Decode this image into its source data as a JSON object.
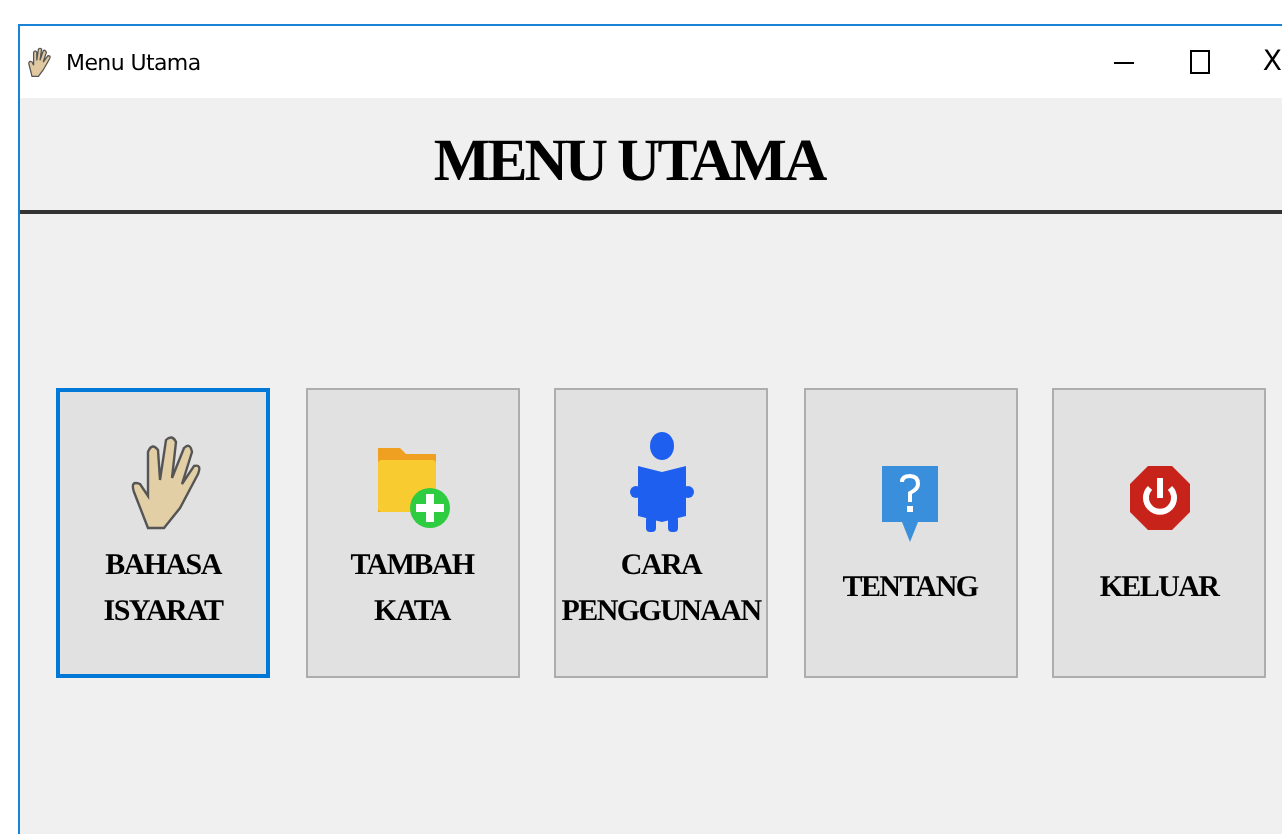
{
  "window": {
    "title": "Menu Utama",
    "close_label": "X"
  },
  "heading": "MENU UTAMA",
  "buttons": [
    {
      "label": "BAHASA\nISYARAT",
      "kind": "hand",
      "selected": true
    },
    {
      "label": "TAMBAH\nKATA",
      "kind": "folder-add",
      "selected": false
    },
    {
      "label": "CARA\nPENGGUNAAN",
      "kind": "reader",
      "selected": false
    },
    {
      "label": "TENTANG",
      "kind": "help",
      "selected": false
    },
    {
      "label": "KELUAR",
      "kind": "power",
      "selected": false
    }
  ]
}
